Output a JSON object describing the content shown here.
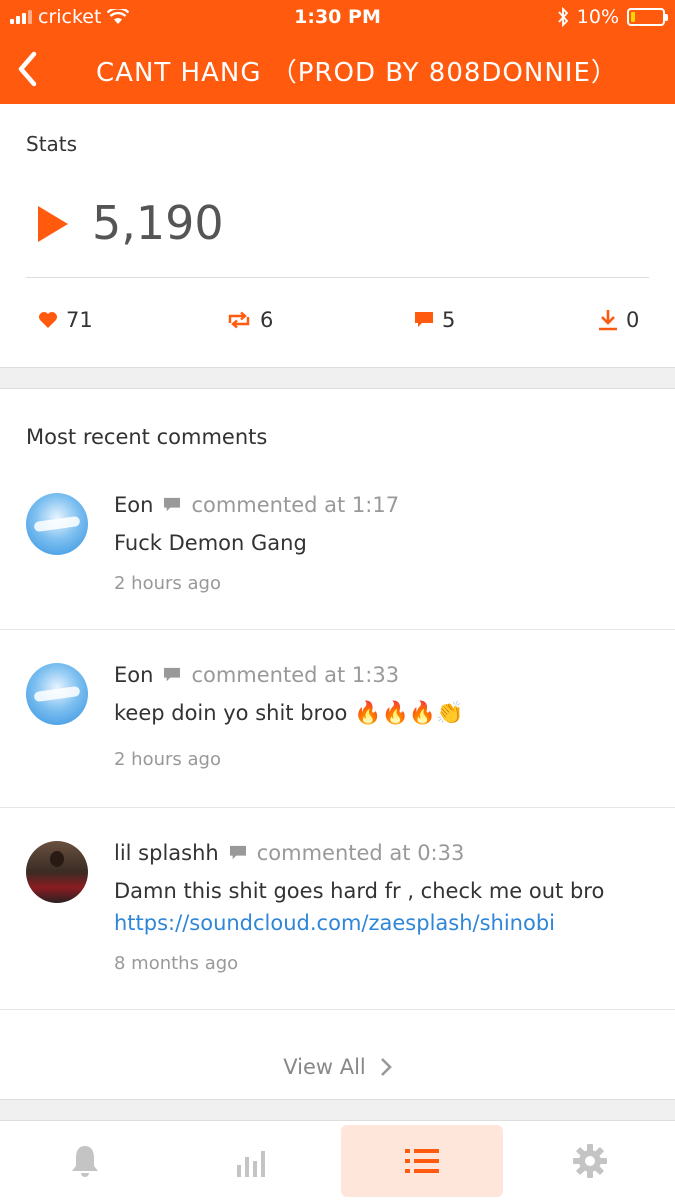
{
  "status_bar": {
    "carrier": "cricket",
    "time": "1:30 PM",
    "battery": "10%"
  },
  "header": {
    "title": "CANT HANG （PROD BY 808DONNIE）"
  },
  "stats": {
    "label": "Stats",
    "plays": "5,190",
    "likes": "71",
    "reposts": "6",
    "comments": "5",
    "downloads": "0"
  },
  "comments_section": {
    "label": "Most recent comments",
    "items": [
      {
        "user": "Eon",
        "meta": "commented at 1:17",
        "text": "Fuck Demon Gang",
        "time": "2 hours ago"
      },
      {
        "user": "Eon",
        "meta": "commented at 1:33",
        "text": "keep doin yo shit broo",
        "emoji": "🔥🔥🔥👏",
        "time": "2 hours ago"
      },
      {
        "user": "lil splashh",
        "meta": "commented at 0:33",
        "text": "Damn this shit goes hard fr , check me out bro",
        "link": "https://soundcloud.com/zaesplash/shinobi",
        "time": "8 months ago"
      }
    ],
    "view_all": "View All"
  },
  "tabbar": {
    "tabs": [
      "notifications",
      "stats",
      "list",
      "settings"
    ],
    "active": "list"
  },
  "colors": {
    "accent": "#ff5a0e",
    "link": "#2f86d8"
  }
}
